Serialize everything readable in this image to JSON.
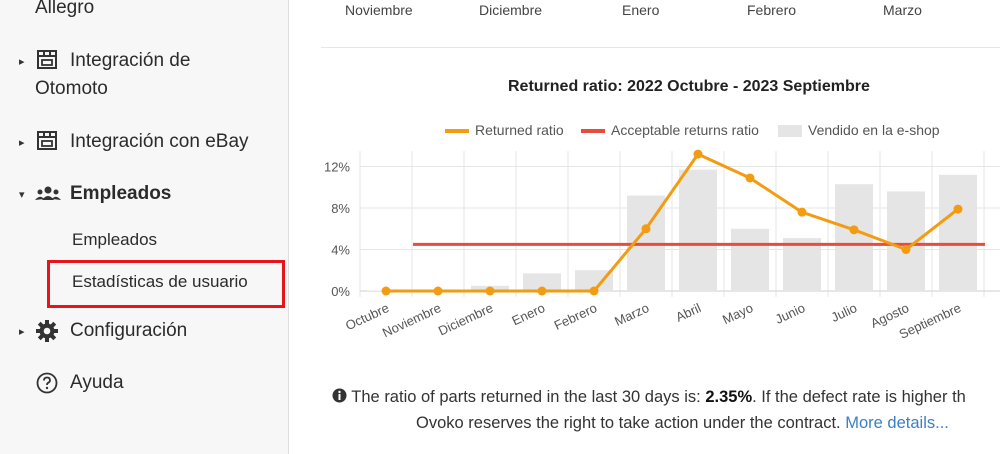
{
  "sidebar": {
    "allegro_label": "Allegro",
    "otomoto_line1": "Integración de",
    "otomoto_line2": "Otomoto",
    "ebay_label": "Integración con eBay",
    "empleados_label": "Empleados",
    "sub_empleados": "Empleados",
    "sub_estadisticas": "Estadísticas de usuario",
    "config_label": "Configuración",
    "ayuda_label": "Ayuda"
  },
  "top_months": [
    "Noviembre",
    "Diciembre",
    "Enero",
    "Febrero",
    "Marzo"
  ],
  "chart_data": {
    "type": "bar",
    "title": "Returned ratio: 2022 Octubre - 2023 Septiembre",
    "categories": [
      "Octubre",
      "Noviembre",
      "Diciembre",
      "Enero",
      "Febrero",
      "Marzo",
      "Abril",
      "Mayo",
      "Junio",
      "Julio",
      "Agosto",
      "Septiembre"
    ],
    "y_ticks": [
      "0%",
      "4%",
      "8%",
      "12%"
    ],
    "ylim": [
      0,
      13.5
    ],
    "series": [
      {
        "name": "Returned ratio",
        "kind": "line",
        "color": "#f39c12",
        "values": [
          0,
          0,
          0,
          0,
          0,
          6.0,
          13.2,
          10.9,
          7.6,
          5.9,
          4.0,
          7.9
        ]
      },
      {
        "name": "Acceptable returns ratio",
        "kind": "line",
        "color": "#e74c3c",
        "values": [
          4.5,
          4.5,
          4.5,
          4.5,
          4.5,
          4.5,
          4.5,
          4.5,
          4.5,
          4.5,
          4.5,
          4.5
        ]
      },
      {
        "name": "Vendido en la e-shop",
        "kind": "bar",
        "color": "#e5e5e5",
        "values": [
          0.05,
          0.1,
          0.5,
          1.7,
          2.0,
          9.2,
          11.7,
          6.0,
          5.1,
          10.3,
          9.6,
          11.2
        ]
      }
    ],
    "grid": true
  },
  "info": {
    "line1_prefix": "The ratio of parts returned in the last 30 days is: ",
    "line1_value": "2.35%",
    "line1_suffix": ". If the defect rate is higher th",
    "line2_text": "Ovoko reserves the right to take action under the contract. ",
    "line2_link": "More details..."
  }
}
